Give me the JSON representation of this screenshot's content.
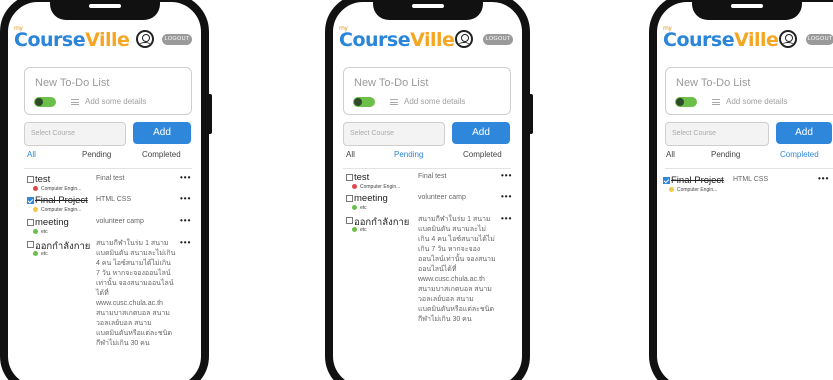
{
  "app": {
    "logo_my": "my",
    "logo_course": "Course",
    "logo_ville": "Ville",
    "logout_label": "LOGOUT",
    "new_todo_placeholder": "New To-Do List",
    "details_placeholder": "Add some details",
    "select_course_placeholder": "Select Course",
    "add_label": "Add",
    "tabs": [
      "All",
      "Pending",
      "Completed"
    ],
    "more_label": "•••"
  },
  "colors": {
    "accent": "#2f87db",
    "toggle": "#6cc04a",
    "dot_red": "#e0484d",
    "dot_yellow": "#f2c84b",
    "dot_green": "#6cc04a"
  },
  "screens": [
    {
      "active_tab": "All",
      "items": [
        {
          "title": "test",
          "checked": false,
          "course": "Computer Engin...",
          "dot": "red",
          "desc": "Final test"
        },
        {
          "title": "Final Project",
          "checked": true,
          "course": "Computer Engin...",
          "dot": "yellow",
          "desc": "HTML CSS"
        },
        {
          "title": "meeting",
          "checked": false,
          "course": "etc",
          "dot": "green",
          "desc": "volunteer camp"
        },
        {
          "title": "ออกกำลังกาย",
          "checked": false,
          "course": "etc",
          "dot": "green",
          "desc": "สนามกีฬาในร่ม 1 สนาม แบดมินตัน สนามละไม่เกิน 4 คน ไอซ์สนามได้ไม่เกิน 7 วัน หากจะจองออนไลน์เท่านั้น จองสนามออนไลน์ได้ที่ www.cusc.chula.ac.th สนามบาสเกตบอล สนามวอลเลย์บอล สนามแบดมินตันหรือแต่ละชนิดกีฬาไม่เกิน 30 คน"
        }
      ]
    },
    {
      "active_tab": "Pending",
      "items": [
        {
          "title": "test",
          "checked": false,
          "course": "Computer Engin...",
          "dot": "red",
          "desc": "Final test"
        },
        {
          "title": "meeting",
          "checked": false,
          "course": "etc",
          "dot": "green",
          "desc": "volunteer camp"
        },
        {
          "title": "ออกกำลังกาย",
          "checked": false,
          "course": "etc",
          "dot": "green",
          "desc": "สนามกีฬาในร่ม 1 สนาม แบดมินตัน สนามละไม่เกิน 4 คน ไอซ์สนามได้ไม่เกิน 7 วัน หากจะจองออนไลน์เท่านั้น จองสนามออนไลน์ได้ที่ www.cusc.chula.ac.th สนามบาสเกตบอล สนามวอลเลย์บอล สนามแบดมินตันหรือแต่ละชนิดกีฬาไม่เกิน 30 คน"
        }
      ]
    },
    {
      "active_tab": "Completed",
      "items": [
        {
          "title": "Final Project",
          "checked": true,
          "course": "Computer Engin...",
          "dot": "yellow",
          "desc": "HTML CSS"
        }
      ]
    }
  ]
}
